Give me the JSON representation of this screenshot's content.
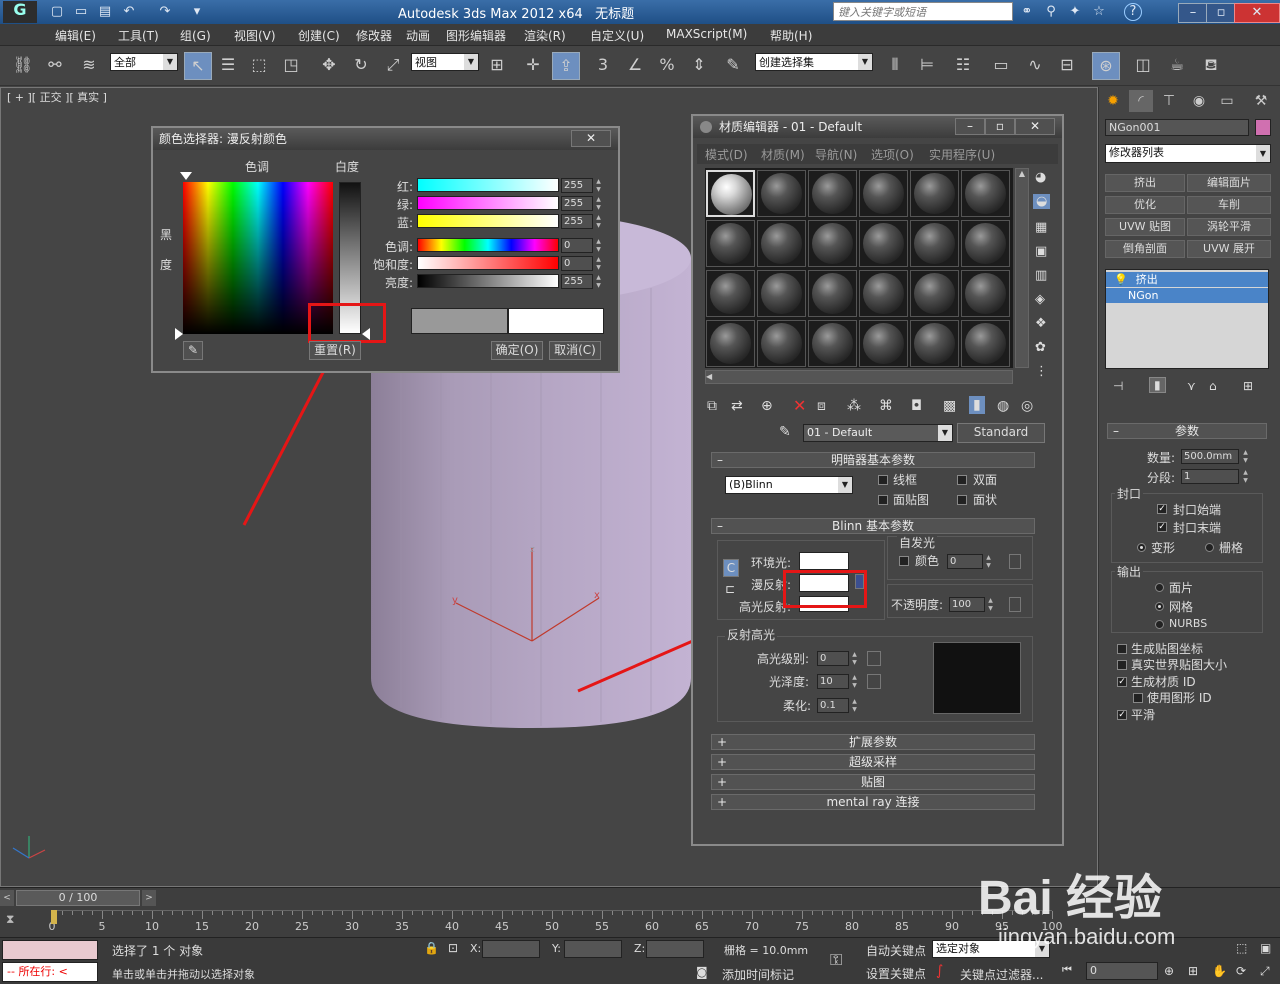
{
  "titlebar": {
    "title": "Autodesk 3ds Max  2012 x64",
    "doc": "无标题",
    "search_placeholder": "键入关键字或短语",
    "help": "?"
  },
  "menu": [
    "编辑(E)",
    "工具(T)",
    "组(G)",
    "视图(V)",
    "创建(C)",
    "修改器",
    "动画",
    "图形编辑器",
    "渲染(R)",
    "自定义(U)",
    "MAXScript(M)",
    "帮助(H)"
  ],
  "toolbar": {
    "filter": "全部",
    "refcoord": "视图",
    "named_set": "创建选择集"
  },
  "viewport": {
    "label": "[ + ][ 正交 ][ 真实 ]",
    "axis_x": "x",
    "axis_y": "y",
    "axis_z": "z"
  },
  "color_picker": {
    "title": "颜色选择器: 漫反射颜色",
    "hue": "色调",
    "whiteness": "白度",
    "blackness": "黑度",
    "red": "红:",
    "green": "绿:",
    "blue": "蓝:",
    "hue_label": "色调:",
    "saturation": "饱和度:",
    "value": "亮度:",
    "red_val": "255",
    "green_val": "255",
    "blue_val": "255",
    "hue_val": "0",
    "sat_val": "0",
    "value_val": "255",
    "reset": "重置(R)",
    "ok": "确定(O)",
    "cancel": "取消(C)",
    "close": "✕"
  },
  "mat_editor": {
    "title": "材质编辑器 - 01 - Default",
    "menu": [
      "模式(D)",
      "材质(M)",
      "导航(N)",
      "选项(O)",
      "实用程序(U)"
    ],
    "material_name": "01 - Default",
    "material_type": "Standard",
    "shader_rollout": "明暗器基本参数",
    "shader": "(B)Blinn",
    "wire": "线框",
    "two_sided": "双面",
    "face_map": "面贴图",
    "faceted": "面状",
    "blinn_rollout": "Blinn 基本参数",
    "self_illum": "自发光",
    "color": "颜色",
    "self_illum_val": "0",
    "ambient": "环境光:",
    "diffuse": "漫反射:",
    "specular": "高光反射:",
    "opacity": "不透明度:",
    "opacity_val": "100",
    "spec_highlights": "反射高光",
    "spec_level": "高光级别:",
    "spec_level_val": "0",
    "glossiness": "光泽度:",
    "gloss_val": "10",
    "soften": "柔化:",
    "soften_val": "0.1",
    "rollouts": [
      "扩展参数",
      "超级采样",
      "贴图",
      "mental ray 连接"
    ],
    "lock_c": "C"
  },
  "cmd_panel": {
    "object_name": "NGon001",
    "object_color": "#d070b0",
    "modifier_list": "修改器列表",
    "buttons": [
      "挤出",
      "编辑面片",
      "优化",
      "车削",
      "UVW 贴图",
      "涡轮平滑",
      "倒角剖面",
      "UVW 展开"
    ],
    "stack": [
      "挤出",
      "NGon"
    ],
    "params": "参数",
    "amount_label": "数量:",
    "amount_val": "500.0mm",
    "segments_label": "分段:",
    "segments_val": "1",
    "capping": "封口",
    "cap_start": "封口始端",
    "cap_end": "封口末端",
    "morph": "变形",
    "grid": "栅格",
    "output": "输出",
    "patch": "面片",
    "mesh": "网格",
    "nurbs": "NURBS",
    "gen_coords": "生成贴图坐标",
    "real_world": "真实世界贴图大小",
    "gen_mat_id": "生成材质 ID",
    "use_shape_id": "使用图形 ID",
    "smooth": "平滑"
  },
  "timeline": {
    "frame": "0 / 100",
    "ticks": [
      "0",
      "5",
      "10",
      "15",
      "20",
      "25",
      "30",
      "35",
      "40",
      "45",
      "50",
      "55",
      "60",
      "65",
      "70",
      "75",
      "80",
      "85",
      "90",
      "95",
      "100"
    ]
  },
  "status": {
    "selected": "选择了 1 个 对象",
    "prompt": "单击或单击并拖动以选择对象",
    "current": "所在行:",
    "x": "X:",
    "y": "Y:",
    "z": "Z:",
    "grid": "栅格 = 10.0mm",
    "add_time_tag": "添加时间标记",
    "auto_key": "自动关键点",
    "set_key": "设置关键点",
    "selected_obj": "选定对象",
    "key_filters": "关键点过滤器...",
    "frame_val": "0"
  },
  "watermark": {
    "text": "Bai 经验",
    "url": "jingyan.baidu.com"
  },
  "colors": {
    "accent": "#e51616",
    "cylinder": "#b8a8c8",
    "selection": "#6d8fbf"
  }
}
